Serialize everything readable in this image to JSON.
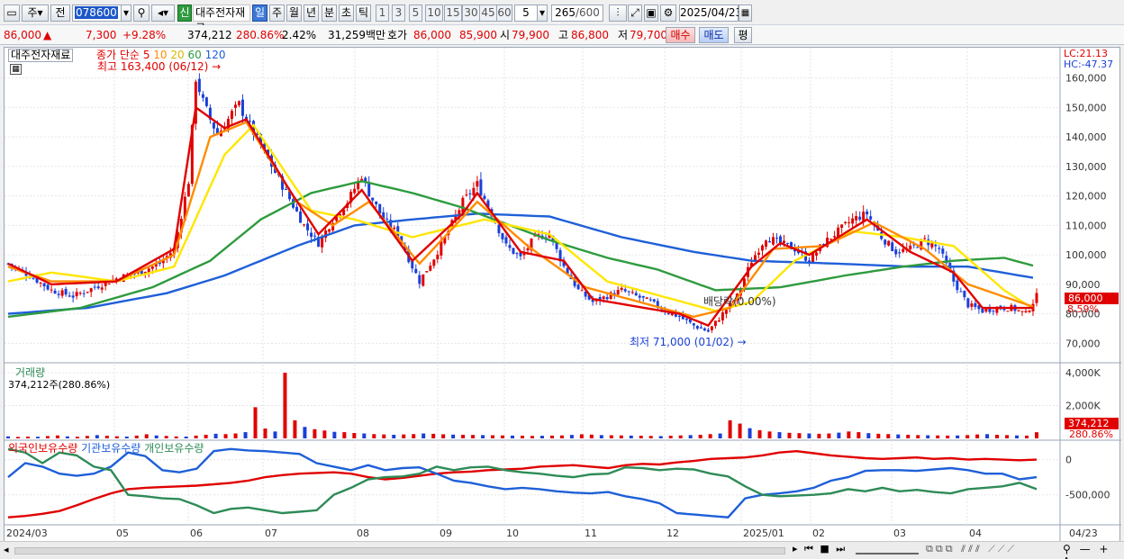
{
  "toolbar": {
    "period_label": "주",
    "prev_label": "전",
    "stock_code": "078600",
    "credit_badge": "신",
    "stock_name": "대주전자재료",
    "period_buttons": [
      "일",
      "주",
      "월",
      "년",
      "분",
      "초",
      "틱"
    ],
    "active_period": "일",
    "minute_buttons": [
      "1",
      "3",
      "5",
      "10",
      "15",
      "30",
      "45",
      "60"
    ],
    "interval_value": "5",
    "count_value": "265",
    "count_total": "/600",
    "date_value": "2025/04/23"
  },
  "quote": {
    "price": "86,000",
    "change": "7,300",
    "change_pct": "+9.28%",
    "volume": "374,212",
    "volume_ratio": "280.86%",
    "turnover": "2.42%",
    "amount": "31,259백만",
    "ask_label": "호가",
    "ask": "86,000",
    "bid": "85,900",
    "open_label": "시",
    "open": "79,900",
    "high_label": "고",
    "high": "86,800",
    "low_label": "저",
    "low": "79,700",
    "buy_button": "매수",
    "sell_button": "매도",
    "eval_button": "평"
  },
  "chart_labels": {
    "stock_tag": "대주전자재료",
    "ma_prefix": "종가 단순",
    "ma_periods": [
      "5",
      "10",
      "20",
      "60",
      "120"
    ],
    "max_annotation": "최고 163,400 (06/12)",
    "min_annotation": "최저 71,000 (01/02)",
    "dividend_annotation": "배당락(0.00%)",
    "lc": "LC:21.13",
    "hc": "HC:-47.37",
    "last_price": "86,000",
    "last_pct": "8.59%",
    "volume_title": "거래량",
    "volume_value": "374,212주(280.86%)",
    "volume_last": "374,212",
    "volume_last_pct": "280.86%",
    "holdings_titles": [
      "외국인보유수량",
      "기관보유수량",
      "개인보유수량"
    ]
  },
  "colors": {
    "ma5": "#e00000",
    "ma10": "#ff8c00",
    "ma20": "#ffe600",
    "ma60": "#2e9b3e",
    "ma120": "#1e5fd8",
    "up": "#e00000",
    "down": "#1a3fd8"
  },
  "chart_data": [
    {
      "type": "candlestick",
      "title": "대주전자재료",
      "x_labels": [
        "2024/03",
        "05",
        "06",
        "07",
        "08",
        "09",
        "10",
        "11",
        "12",
        "2025/01",
        "02",
        "03",
        "04",
        "04/23"
      ],
      "y_ticks": [
        70000,
        80000,
        90000,
        100000,
        110000,
        120000,
        130000,
        140000,
        150000,
        160000
      ],
      "y_tick_labels": [
        "70,000",
        "80,000",
        "90,000",
        "100,000",
        "110,000",
        "120,000",
        "130,000",
        "140,000",
        "150,000",
        "160,000"
      ],
      "ylim": [
        64000,
        166000
      ],
      "price_path": [
        [
          0,
          97000
        ],
        [
          6,
          93000
        ],
        [
          12,
          88000
        ],
        [
          18,
          86000
        ],
        [
          24,
          89000
        ],
        [
          30,
          92000
        ],
        [
          36,
          94000
        ],
        [
          42,
          97000
        ],
        [
          46,
          102000
        ],
        [
          50,
          125000
        ],
        [
          52,
          160000
        ],
        [
          54,
          152000
        ],
        [
          56,
          146000
        ],
        [
          58,
          141000
        ],
        [
          60,
          144000
        ],
        [
          62,
          148000
        ],
        [
          64,
          151000
        ],
        [
          66,
          146000
        ],
        [
          70,
          137000
        ],
        [
          74,
          128000
        ],
        [
          78,
          119000
        ],
        [
          82,
          110000
        ],
        [
          86,
          104000
        ],
        [
          90,
          112000
        ],
        [
          94,
          118000
        ],
        [
          98,
          127000
        ],
        [
          100,
          121000
        ],
        [
          104,
          112000
        ],
        [
          108,
          107000
        ],
        [
          112,
          96000
        ],
        [
          114,
          91000
        ],
        [
          118,
          99000
        ],
        [
          122,
          108000
        ],
        [
          126,
          118000
        ],
        [
          130,
          124000
        ],
        [
          134,
          114000
        ],
        [
          138,
          103000
        ],
        [
          142,
          99000
        ],
        [
          146,
          106000
        ],
        [
          150,
          107000
        ],
        [
          154,
          96000
        ],
        [
          158,
          88000
        ],
        [
          162,
          84000
        ],
        [
          166,
          86000
        ],
        [
          170,
          88000
        ],
        [
          174,
          86000
        ],
        [
          178,
          84000
        ],
        [
          182,
          81000
        ],
        [
          186,
          79000
        ],
        [
          190,
          76000
        ],
        [
          194,
          74000
        ],
        [
          198,
          80000
        ],
        [
          202,
          86000
        ],
        [
          206,
          98000
        ],
        [
          210,
          106000
        ],
        [
          214,
          104000
        ],
        [
          218,
          102000
        ],
        [
          222,
          98000
        ],
        [
          226,
          104000
        ],
        [
          230,
          108000
        ],
        [
          234,
          112000
        ],
        [
          238,
          114000
        ],
        [
          242,
          106000
        ],
        [
          246,
          101000
        ],
        [
          250,
          102000
        ],
        [
          254,
          105000
        ],
        [
          258,
          102000
        ],
        [
          262,
          91000
        ],
        [
          266,
          83000
        ],
        [
          270,
          81000
        ],
        [
          274,
          82000
        ],
        [
          278,
          82000
        ],
        [
          282,
          80000
        ],
        [
          285,
          86000
        ]
      ],
      "ma5_path": [
        [
          0,
          97000
        ],
        [
          12,
          90000
        ],
        [
          30,
          91000
        ],
        [
          46,
          102000
        ],
        [
          52,
          150000
        ],
        [
          60,
          143000
        ],
        [
          66,
          146000
        ],
        [
          78,
          122000
        ],
        [
          86,
          107000
        ],
        [
          98,
          122000
        ],
        [
          112,
          98000
        ],
        [
          126,
          114000
        ],
        [
          130,
          121000
        ],
        [
          142,
          101000
        ],
        [
          154,
          98000
        ],
        [
          162,
          85000
        ],
        [
          186,
          80000
        ],
        [
          194,
          76000
        ],
        [
          206,
          96000
        ],
        [
          214,
          104000
        ],
        [
          222,
          100000
        ],
        [
          238,
          112000
        ],
        [
          250,
          101000
        ],
        [
          262,
          94000
        ],
        [
          270,
          82000
        ],
        [
          285,
          82000
        ]
      ],
      "ma10_path": [
        [
          0,
          96000
        ],
        [
          12,
          91000
        ],
        [
          30,
          91000
        ],
        [
          46,
          100000
        ],
        [
          56,
          140000
        ],
        [
          66,
          145000
        ],
        [
          80,
          118000
        ],
        [
          90,
          110000
        ],
        [
          100,
          118000
        ],
        [
          114,
          97000
        ],
        [
          130,
          118000
        ],
        [
          144,
          103000
        ],
        [
          160,
          89000
        ],
        [
          190,
          79000
        ],
        [
          200,
          82000
        ],
        [
          212,
          102000
        ],
        [
          226,
          103000
        ],
        [
          240,
          111000
        ],
        [
          254,
          102000
        ],
        [
          266,
          90000
        ],
        [
          285,
          82000
        ]
      ],
      "ma20_path": [
        [
          0,
          91000
        ],
        [
          12,
          94000
        ],
        [
          30,
          91000
        ],
        [
          46,
          96000
        ],
        [
          60,
          134000
        ],
        [
          68,
          144000
        ],
        [
          84,
          115000
        ],
        [
          96,
          112000
        ],
        [
          112,
          106000
        ],
        [
          132,
          112000
        ],
        [
          150,
          107000
        ],
        [
          166,
          91000
        ],
        [
          196,
          81000
        ],
        [
          206,
          84000
        ],
        [
          218,
          98000
        ],
        [
          234,
          108000
        ],
        [
          248,
          106000
        ],
        [
          262,
          103000
        ],
        [
          276,
          88000
        ],
        [
          285,
          81000
        ]
      ],
      "ma60_path": [
        [
          0,
          79000
        ],
        [
          20,
          82000
        ],
        [
          40,
          89000
        ],
        [
          56,
          98000
        ],
        [
          70,
          112000
        ],
        [
          84,
          121000
        ],
        [
          98,
          125000
        ],
        [
          112,
          121000
        ],
        [
          126,
          116000
        ],
        [
          150,
          105000
        ],
        [
          166,
          99000
        ],
        [
          180,
          95000
        ],
        [
          196,
          88000
        ],
        [
          214,
          89000
        ],
        [
          232,
          93000
        ],
        [
          248,
          96000
        ],
        [
          262,
          98000
        ],
        [
          276,
          99000
        ],
        [
          285,
          96000
        ]
      ],
      "ma120_path": [
        [
          0,
          80000
        ],
        [
          22,
          82000
        ],
        [
          44,
          87000
        ],
        [
          60,
          93000
        ],
        [
          80,
          103000
        ],
        [
          96,
          110000
        ],
        [
          112,
          112000
        ],
        [
          130,
          114000
        ],
        [
          150,
          113000
        ],
        [
          170,
          106000
        ],
        [
          190,
          101000
        ],
        [
          206,
          98000
        ],
        [
          230,
          97000
        ],
        [
          250,
          96000
        ],
        [
          266,
          96000
        ],
        [
          285,
          92000
        ]
      ]
    },
    {
      "type": "bar",
      "title": "거래량",
      "y_ticks": [
        2000000,
        4000000
      ],
      "y_tick_labels": [
        "2,000K",
        "4,000K"
      ],
      "ylim": [
        0,
        4500000
      ],
      "values": [
        120000,
        90000,
        110000,
        100000,
        140000,
        180000,
        120000,
        100000,
        150000,
        200000,
        160000,
        130000,
        110000,
        170000,
        250000,
        180000,
        150000,
        120000,
        110000,
        170000,
        220000,
        280000,
        260000,
        300000,
        380000,
        1900000,
        600000,
        420000,
        4000000,
        1100000,
        700000,
        560000,
        480000,
        400000,
        380000,
        330000,
        300000,
        260000,
        240000,
        220000,
        240000,
        260000,
        300000,
        280000,
        250000,
        230000,
        220000,
        210000,
        200000,
        190000,
        180000,
        170000,
        160000,
        150000,
        160000,
        170000,
        180000,
        210000,
        250000,
        230000,
        200000,
        190000,
        180000,
        170000,
        160000,
        150000,
        140000,
        160000,
        180000,
        200000,
        220000,
        260000,
        300000,
        1100000,
        900000,
        620000,
        500000,
        420000,
        380000,
        340000,
        320000,
        300000,
        280000,
        300000,
        350000,
        420000,
        380000,
        320000,
        280000,
        260000,
        240000,
        220000,
        200000,
        190000,
        180000,
        170000,
        180000,
        200000,
        240000,
        260000,
        220000,
        200000,
        180000,
        170000,
        374212
      ]
    },
    {
      "type": "line",
      "title": "외국인보유수량 / 기관보유수량 / 개인보유수량",
      "y_ticks": [
        0,
        -500000
      ],
      "y_tick_labels": [
        "0",
        "-500,000"
      ],
      "series": [
        {
          "name": "외국인보유수량",
          "color": "#e00000",
          "values": [
            -820000,
            -800000,
            -770000,
            -730000,
            -650000,
            -560000,
            -480000,
            -420000,
            -400000,
            -390000,
            -380000,
            -370000,
            -350000,
            -330000,
            -300000,
            -250000,
            -220000,
            -200000,
            -190000,
            -180000,
            -200000,
            -250000,
            -280000,
            -260000,
            -230000,
            -200000,
            -180000,
            -170000,
            -150000,
            -140000,
            -130000,
            -100000,
            -90000,
            -80000,
            -100000,
            -120000,
            -80000,
            -60000,
            -70000,
            -40000,
            -20000,
            10000,
            20000,
            30000,
            60000,
            100000,
            120000,
            90000,
            60000,
            40000,
            20000,
            10000,
            20000,
            30000,
            10000,
            20000,
            0,
            10000,
            0,
            -10000,
            0
          ]
        },
        {
          "name": "기관보유수량",
          "color": "#1e5fd8",
          "values": [
            -250000,
            -50000,
            -100000,
            -200000,
            -230000,
            -200000,
            -100000,
            100000,
            50000,
            -150000,
            -180000,
            -130000,
            120000,
            150000,
            130000,
            120000,
            100000,
            80000,
            -50000,
            -100000,
            -150000,
            -80000,
            -150000,
            -120000,
            -110000,
            -200000,
            -300000,
            -330000,
            -380000,
            -420000,
            -400000,
            -420000,
            -450000,
            -470000,
            -480000,
            -460000,
            -520000,
            -560000,
            -620000,
            -760000,
            -780000,
            -800000,
            -820000,
            -550000,
            -500000,
            -480000,
            -450000,
            -400000,
            -300000,
            -250000,
            -160000,
            -150000,
            -150000,
            -160000,
            -140000,
            -120000,
            -150000,
            -200000,
            -200000,
            -280000,
            -250000
          ]
        },
        {
          "name": "개인보유수량",
          "color": "#2e8b57",
          "values": [
            150000,
            100000,
            -50000,
            100000,
            60000,
            -100000,
            -150000,
            -500000,
            -520000,
            -550000,
            -560000,
            -650000,
            -760000,
            -700000,
            -680000,
            -720000,
            -760000,
            -740000,
            -720000,
            -500000,
            -400000,
            -280000,
            -250000,
            -240000,
            -200000,
            -100000,
            -150000,
            -110000,
            -100000,
            -150000,
            -180000,
            -200000,
            -230000,
            -250000,
            -210000,
            -200000,
            -110000,
            -120000,
            -150000,
            -130000,
            -140000,
            -200000,
            -240000,
            -380000,
            -500000,
            -520000,
            -510000,
            -500000,
            -480000,
            -420000,
            -450000,
            -400000,
            -450000,
            -430000,
            -460000,
            -480000,
            -420000,
            -400000,
            -380000,
            -330000,
            -420000
          ]
        }
      ]
    }
  ]
}
